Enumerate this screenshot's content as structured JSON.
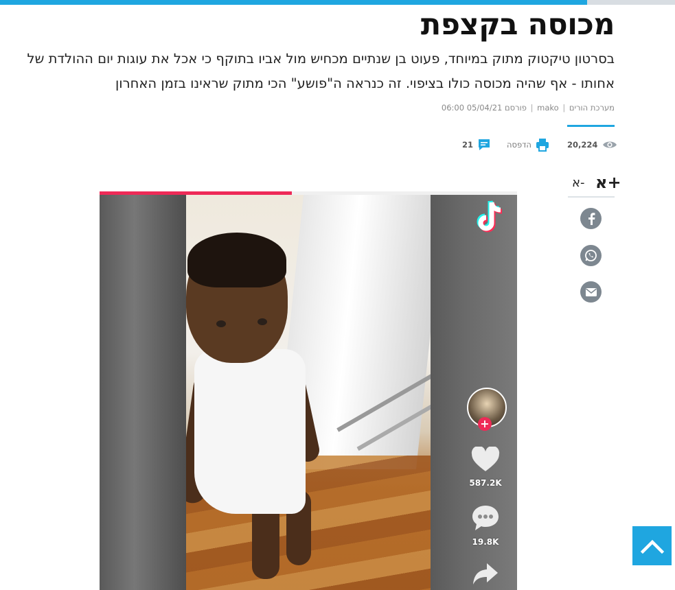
{
  "page": {
    "progress_bar_fraction": 0.87,
    "accent_color": "#1fa6e0"
  },
  "article": {
    "headline": "מכוסה בקצפת",
    "subtitle": "בסרטון טיקטוק מתוק במיוחד, פעוט בן שנתיים מכחיש מול אביו בתוקף כי אכל את עוגות יום ההולדת של אחותו - אף שהיה מכוסה כולו בציפוי. זה כנראה ה\"פושע\" הכי מתוק שראינו בזמן האחרון",
    "byline": {
      "author": "מערכת הורים",
      "source": "mako",
      "published_label": "פורסם 05/04/21 06:00"
    }
  },
  "toolbar": {
    "views": "20,224",
    "views_icon": "eye-icon",
    "print_label": "הדפסה",
    "print_icon": "printer-icon",
    "comments_count": "21",
    "comments_icon": "comment-icon"
  },
  "font_size": {
    "increase": "א+",
    "decrease": "א-"
  },
  "share": [
    {
      "name": "facebook",
      "icon": "facebook-icon"
    },
    {
      "name": "whatsapp",
      "icon": "whatsapp-icon"
    },
    {
      "name": "email",
      "icon": "mail-icon"
    }
  ],
  "video": {
    "platform_icon": "tiktok-logo-icon",
    "progress_fraction": 0.46,
    "progress_color": "#ee2a57",
    "likes": "587.2K",
    "comments": "19.8K",
    "follow_symbol": "+"
  }
}
